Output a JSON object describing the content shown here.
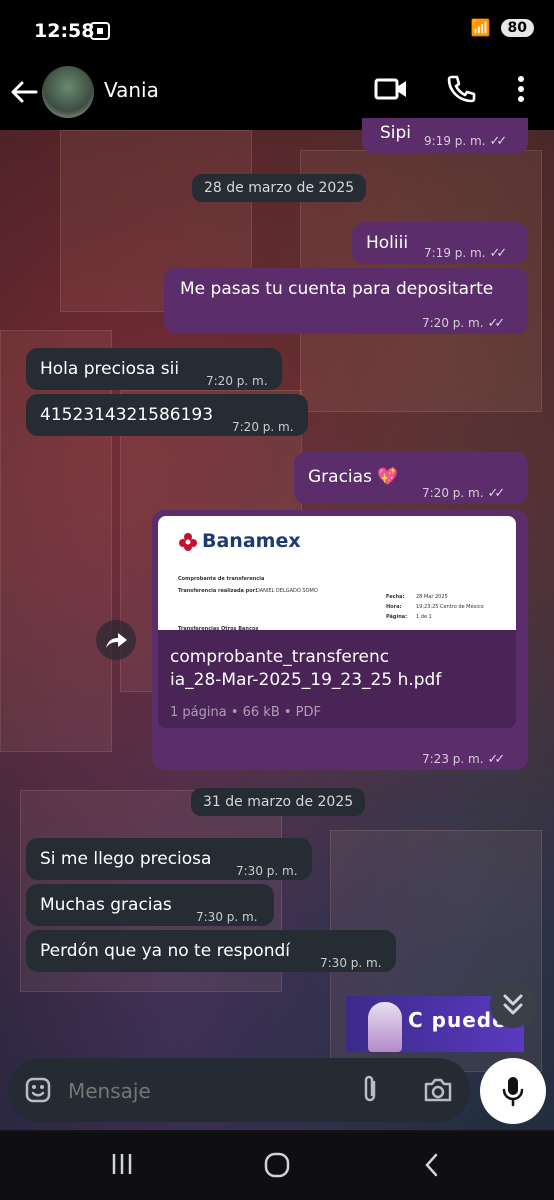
{
  "status_bar": {
    "time": "12:58",
    "battery": "80"
  },
  "header": {
    "contact_name": "Vania"
  },
  "messages": [
    {
      "text": "Sipi",
      "time": "9:19 p. m."
    },
    {
      "date": "28 de marzo de 2025"
    },
    {
      "text": "Holiii",
      "time": "7:19 p. m."
    },
    {
      "text": "Me pasas tu cuenta para depositarte",
      "time": "7:20 p. m."
    },
    {
      "text": "Hola preciosa sii",
      "time": "7:20 p. m."
    },
    {
      "text": "4152314321586193",
      "time": "7:20 p. m."
    },
    {
      "text": "Gracias 💖",
      "time": "7:20 p. m."
    },
    {
      "time": "7:23 p. m."
    },
    {
      "date": "31 de marzo de 2025"
    },
    {
      "text": "Si me llego preciosa",
      "time": "7:30 p. m."
    },
    {
      "text": "Muchas gracias",
      "time": "7:30 p. m."
    },
    {
      "text": "Perdón que ya no te respondí",
      "time": "7:30 p. m."
    }
  ],
  "pdf": {
    "brand": "Banamex",
    "doc_title": "Comprobante de transferencia",
    "realizada_label": "Transferencia realizada por:",
    "realizada_value": "DANIEL DELGADO SOMO",
    "fecha_label": "Fecha:",
    "fecha_value": "28 Mar 2025",
    "hora_label": "Hora:",
    "hora_value": "19:23:25 Centro de México",
    "pagina_label": "Página:",
    "pagina_value": "1 de 1",
    "section": "Transferencias Otros Bancos",
    "filename_line1": "comprobante_transferenc",
    "filename_line2": "ia_28-Mar-2025_19_23_25 h.pdf",
    "file_meta": "1 página • 66 kB • PDF"
  },
  "sticker_text": "C puede",
  "composer": {
    "placeholder": "Mensaje"
  },
  "colors": {
    "outgoing": "#5b2e6b",
    "incoming": "#262c33",
    "background": "#000000"
  },
  "icons": [
    "back-arrow-icon",
    "video-call-icon",
    "phone-icon",
    "more-icon",
    "emoji-icon",
    "attach-icon",
    "camera-icon",
    "mic-icon",
    "forward-icon",
    "chevron-down-icon"
  ]
}
